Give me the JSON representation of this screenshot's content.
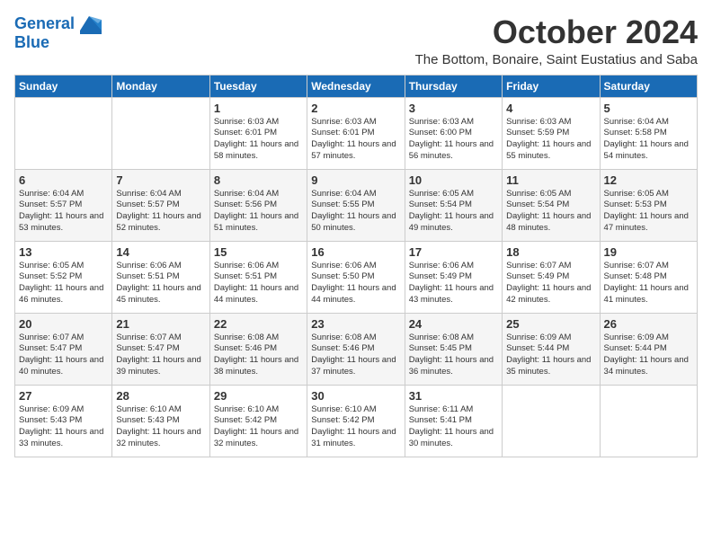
{
  "logo": {
    "line1": "General",
    "line2": "Blue"
  },
  "title": "October 2024",
  "location": "The Bottom, Bonaire, Saint Eustatius and Saba",
  "weekdays": [
    "Sunday",
    "Monday",
    "Tuesday",
    "Wednesday",
    "Thursday",
    "Friday",
    "Saturday"
  ],
  "weeks": [
    [
      {
        "day": "",
        "info": ""
      },
      {
        "day": "",
        "info": ""
      },
      {
        "day": "1",
        "info": "Sunrise: 6:03 AM\nSunset: 6:01 PM\nDaylight: 11 hours and 58 minutes."
      },
      {
        "day": "2",
        "info": "Sunrise: 6:03 AM\nSunset: 6:01 PM\nDaylight: 11 hours and 57 minutes."
      },
      {
        "day": "3",
        "info": "Sunrise: 6:03 AM\nSunset: 6:00 PM\nDaylight: 11 hours and 56 minutes."
      },
      {
        "day": "4",
        "info": "Sunrise: 6:03 AM\nSunset: 5:59 PM\nDaylight: 11 hours and 55 minutes."
      },
      {
        "day": "5",
        "info": "Sunrise: 6:04 AM\nSunset: 5:58 PM\nDaylight: 11 hours and 54 minutes."
      }
    ],
    [
      {
        "day": "6",
        "info": "Sunrise: 6:04 AM\nSunset: 5:57 PM\nDaylight: 11 hours and 53 minutes."
      },
      {
        "day": "7",
        "info": "Sunrise: 6:04 AM\nSunset: 5:57 PM\nDaylight: 11 hours and 52 minutes."
      },
      {
        "day": "8",
        "info": "Sunrise: 6:04 AM\nSunset: 5:56 PM\nDaylight: 11 hours and 51 minutes."
      },
      {
        "day": "9",
        "info": "Sunrise: 6:04 AM\nSunset: 5:55 PM\nDaylight: 11 hours and 50 minutes."
      },
      {
        "day": "10",
        "info": "Sunrise: 6:05 AM\nSunset: 5:54 PM\nDaylight: 11 hours and 49 minutes."
      },
      {
        "day": "11",
        "info": "Sunrise: 6:05 AM\nSunset: 5:54 PM\nDaylight: 11 hours and 48 minutes."
      },
      {
        "day": "12",
        "info": "Sunrise: 6:05 AM\nSunset: 5:53 PM\nDaylight: 11 hours and 47 minutes."
      }
    ],
    [
      {
        "day": "13",
        "info": "Sunrise: 6:05 AM\nSunset: 5:52 PM\nDaylight: 11 hours and 46 minutes."
      },
      {
        "day": "14",
        "info": "Sunrise: 6:06 AM\nSunset: 5:51 PM\nDaylight: 11 hours and 45 minutes."
      },
      {
        "day": "15",
        "info": "Sunrise: 6:06 AM\nSunset: 5:51 PM\nDaylight: 11 hours and 44 minutes."
      },
      {
        "day": "16",
        "info": "Sunrise: 6:06 AM\nSunset: 5:50 PM\nDaylight: 11 hours and 44 minutes."
      },
      {
        "day": "17",
        "info": "Sunrise: 6:06 AM\nSunset: 5:49 PM\nDaylight: 11 hours and 43 minutes."
      },
      {
        "day": "18",
        "info": "Sunrise: 6:07 AM\nSunset: 5:49 PM\nDaylight: 11 hours and 42 minutes."
      },
      {
        "day": "19",
        "info": "Sunrise: 6:07 AM\nSunset: 5:48 PM\nDaylight: 11 hours and 41 minutes."
      }
    ],
    [
      {
        "day": "20",
        "info": "Sunrise: 6:07 AM\nSunset: 5:47 PM\nDaylight: 11 hours and 40 minutes."
      },
      {
        "day": "21",
        "info": "Sunrise: 6:07 AM\nSunset: 5:47 PM\nDaylight: 11 hours and 39 minutes."
      },
      {
        "day": "22",
        "info": "Sunrise: 6:08 AM\nSunset: 5:46 PM\nDaylight: 11 hours and 38 minutes."
      },
      {
        "day": "23",
        "info": "Sunrise: 6:08 AM\nSunset: 5:46 PM\nDaylight: 11 hours and 37 minutes."
      },
      {
        "day": "24",
        "info": "Sunrise: 6:08 AM\nSunset: 5:45 PM\nDaylight: 11 hours and 36 minutes."
      },
      {
        "day": "25",
        "info": "Sunrise: 6:09 AM\nSunset: 5:44 PM\nDaylight: 11 hours and 35 minutes."
      },
      {
        "day": "26",
        "info": "Sunrise: 6:09 AM\nSunset: 5:44 PM\nDaylight: 11 hours and 34 minutes."
      }
    ],
    [
      {
        "day": "27",
        "info": "Sunrise: 6:09 AM\nSunset: 5:43 PM\nDaylight: 11 hours and 33 minutes."
      },
      {
        "day": "28",
        "info": "Sunrise: 6:10 AM\nSunset: 5:43 PM\nDaylight: 11 hours and 32 minutes."
      },
      {
        "day": "29",
        "info": "Sunrise: 6:10 AM\nSunset: 5:42 PM\nDaylight: 11 hours and 32 minutes."
      },
      {
        "day": "30",
        "info": "Sunrise: 6:10 AM\nSunset: 5:42 PM\nDaylight: 11 hours and 31 minutes."
      },
      {
        "day": "31",
        "info": "Sunrise: 6:11 AM\nSunset: 5:41 PM\nDaylight: 11 hours and 30 minutes."
      },
      {
        "day": "",
        "info": ""
      },
      {
        "day": "",
        "info": ""
      }
    ]
  ]
}
